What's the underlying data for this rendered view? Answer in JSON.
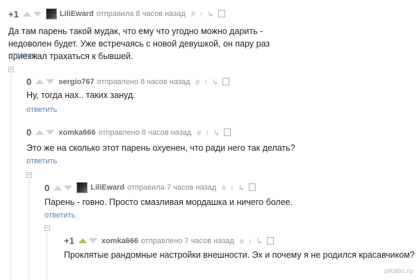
{
  "comments": [
    {
      "rating": "+1",
      "author": "LiliEward",
      "meta": "отправила 8 часов назад",
      "text": "Да там парень такой мудак, что ему что угодно можно дарить - недоволен будет. Уже встречаясь с новой девушкой, он пару раз приезжал трахаться к бывшей.",
      "reply": "ответить"
    },
    {
      "rating": "0",
      "author": "sergio767",
      "meta": "отправлено 8 часов назад",
      "text": "Ну, тогда нах.. таких зануд.",
      "reply": "ответить"
    },
    {
      "rating": "0",
      "author": "xomka666",
      "meta": "отправлено 8 часов назад",
      "text": "Это же на сколько этот парень охуенен, что ради него так делать?",
      "reply": "ответить"
    },
    {
      "rating": "0",
      "author": "LiliEward",
      "meta": "отправила 7 часов назад",
      "text": "Парень - говно. Просто смазливая мордашка и ничего более.",
      "reply": "ответить"
    },
    {
      "rating": "+1",
      "author": "xomka666",
      "meta": "отправлено 7 часов назад",
      "text": "Проклятые рандомные настройки внешности. Эх и почему я не родился красавчиком?",
      "reply": ""
    }
  ],
  "icons": [
    "hash-icon",
    "arrow-up-icon",
    "reply-branch-icon",
    "save-icon"
  ],
  "watermark": "pikabu.ru",
  "colors": {
    "link": "#5a7fb2",
    "upvote_active": "#9ccc3c",
    "meta": "#8a8a8a"
  }
}
